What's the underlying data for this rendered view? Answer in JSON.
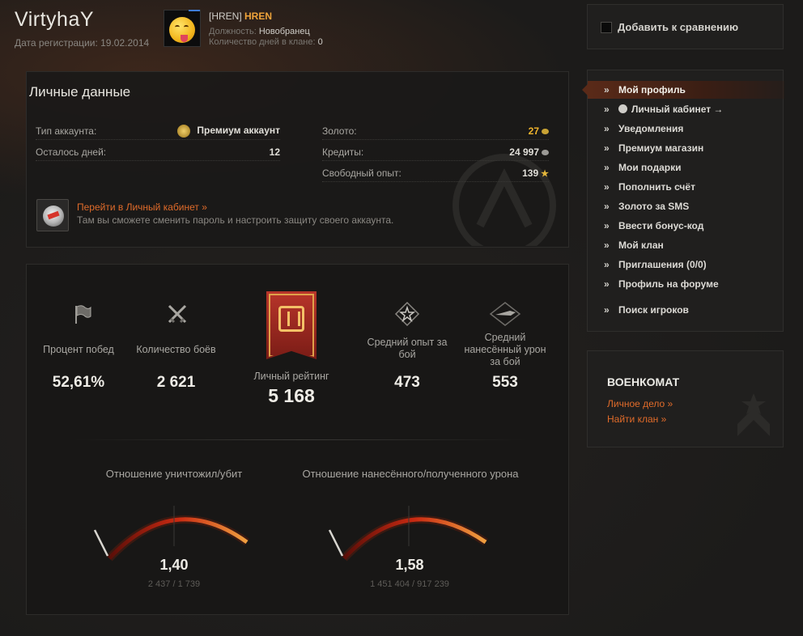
{
  "header": {
    "username": "VirtyhaY",
    "registration": "Дата регистрации: 19.02.2014"
  },
  "clan": {
    "tag": "[HREN]",
    "name": "HREN",
    "position_label": "Должность:",
    "position_value": "Новобранец",
    "days_label": "Количество дней в клане:",
    "days_value": "0"
  },
  "compare": {
    "label": "Добавить к сравнению"
  },
  "personal": {
    "title": "Личные данные",
    "account_type_label": "Тип аккаунта:",
    "account_type_value": "Премиум аккаунт",
    "days_left_label": "Осталось дней:",
    "days_left_value": "12",
    "gold_label": "Золото:",
    "gold_value": "27",
    "credits_label": "Кредиты:",
    "credits_value": "24 997",
    "free_xp_label": "Свободный опыт:",
    "free_xp_value": "139",
    "cabinet_link": "Перейти в Личный кабинет »",
    "cabinet_desc": "Там вы сможете сменить пароль и настроить защиту своего аккаунта."
  },
  "stats": {
    "winrate_label": "Процент побед",
    "winrate_value": "52,61%",
    "battles_label": "Количество боёв",
    "battles_value": "2 621",
    "rating_label": "Личный рейтинг",
    "rating_value": "5 168",
    "avg_xp_label": "Средний опыт за бой",
    "avg_xp_value": "473",
    "avg_dmg_label": "Средний нанесённый урон за бой",
    "avg_dmg_value": "553"
  },
  "gauges": {
    "kd_title": "Отношение уничтожил/убит",
    "kd_value": "1,40",
    "kd_sub": "2 437 / 1 739",
    "dmg_title": "Отношение нанесённого/полученного урона",
    "dmg_value": "1,58",
    "dmg_sub": "1 451 404 / 917 239"
  },
  "menu": {
    "items": [
      "Мой профиль",
      "Личный кабинет →",
      "Уведомления",
      "Премиум магазин",
      "Мои подарки",
      "Пополнить счёт",
      "Золото за SMS",
      "Ввести бонус-код",
      "Мой клан",
      "Приглашения (0/0)",
      "Профиль на форуме",
      "Поиск игроков"
    ]
  },
  "voenkomat": {
    "title": "ВОЕНКОМАТ",
    "link1": "Личное дело »",
    "link2": "Найти клан »"
  },
  "colors": {
    "accent_orange": "#e06b2a",
    "gold": "#f2b52c",
    "menu_active": "#5a2a18"
  }
}
